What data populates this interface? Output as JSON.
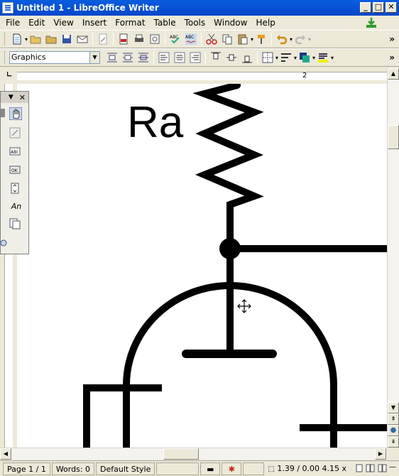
{
  "window": {
    "title": "Untitled 1 - LibreOffice Writer",
    "minimize": "_",
    "maximize": "□",
    "close": "✕"
  },
  "menu": [
    "File",
    "Edit",
    "View",
    "Insert",
    "Format",
    "Table",
    "Tools",
    "Window",
    "Help"
  ],
  "toolbar2": {
    "style_combo": "Graphics",
    "more": "»"
  },
  "ruler": {
    "mark": "2"
  },
  "drawing": {
    "label": "Ra"
  },
  "formbar": {
    "close": "✕",
    "text_icon": "An"
  },
  "status": {
    "page": "Page 1 / 1",
    "words": "Words: 0",
    "style": "Default Style",
    "position": "1.39 / 0.00",
    "size": "4.15 x"
  },
  "colors": {
    "titlebar": "#0a5de0",
    "chrome": "#ece9d8",
    "accent_green": "#2e9b2e"
  }
}
